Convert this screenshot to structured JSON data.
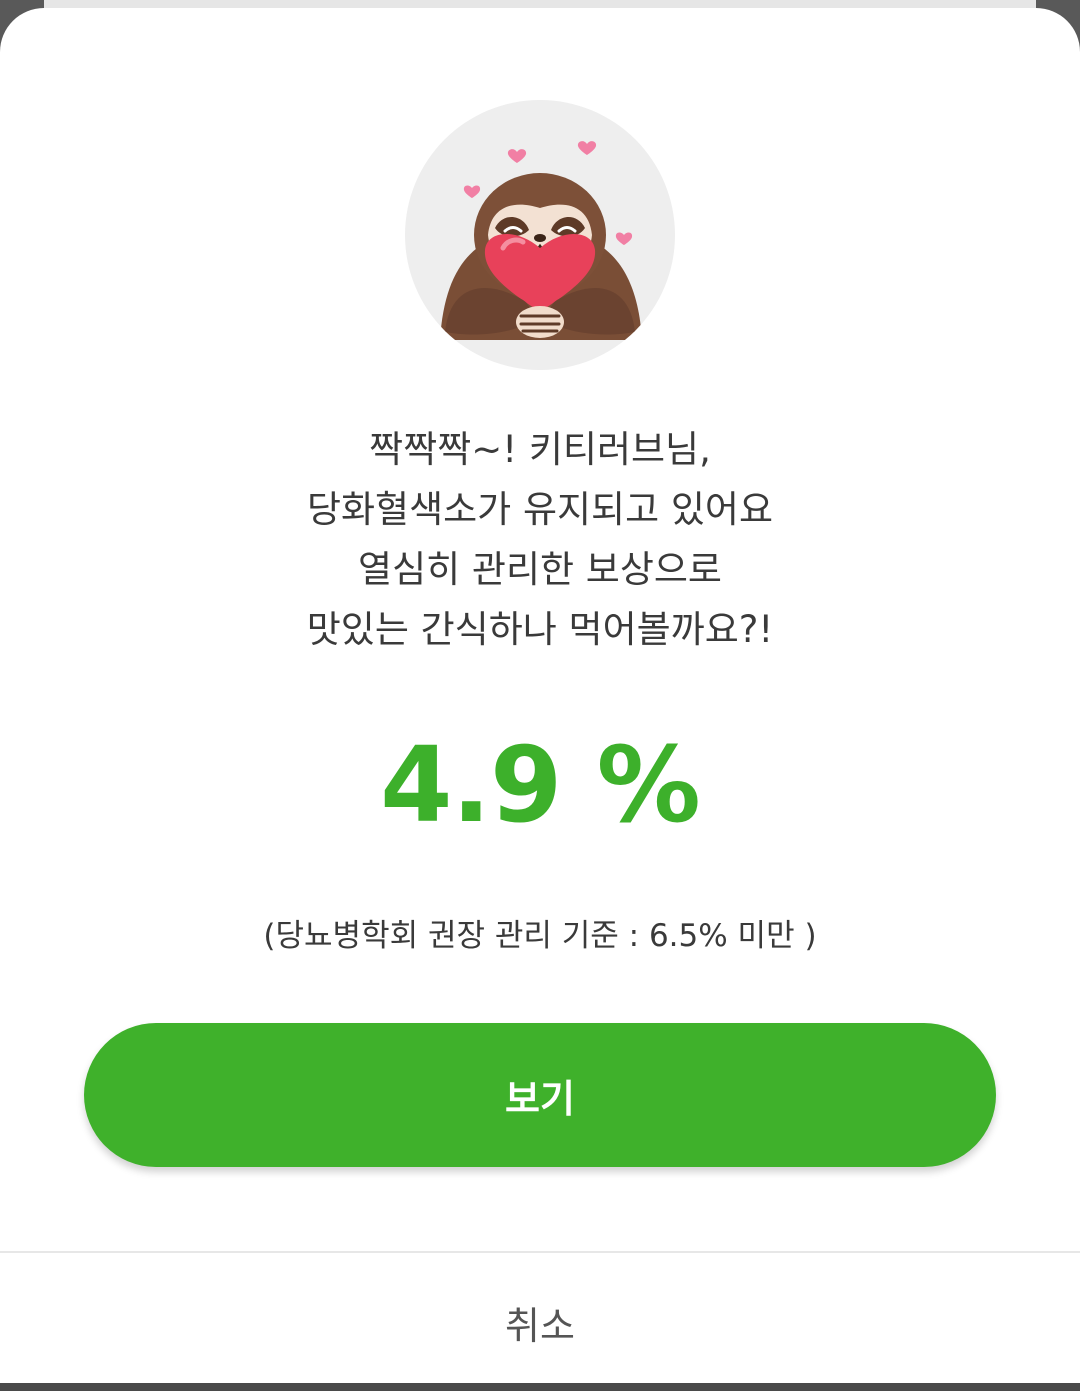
{
  "dialog": {
    "avatar_icon": "sloth-holding-heart-icon",
    "message_lines": [
      "짝짝짝~! 키티러브님,",
      "당화혈색소가 유지되고 있어요",
      "열심히 관리한 보상으로",
      "맛있는 간식하나 먹어볼까요?!"
    ],
    "value": "4.9 %",
    "standard": "(당뇨병학회 권장 관리 기준 : 6.5% 미만 )",
    "primary_button": "보기",
    "cancel_button": "취소"
  },
  "colors": {
    "accent": "#3fb12b",
    "value_text": "#3db02b",
    "body_text": "#3a3a3a",
    "cancel_text": "#555555"
  }
}
